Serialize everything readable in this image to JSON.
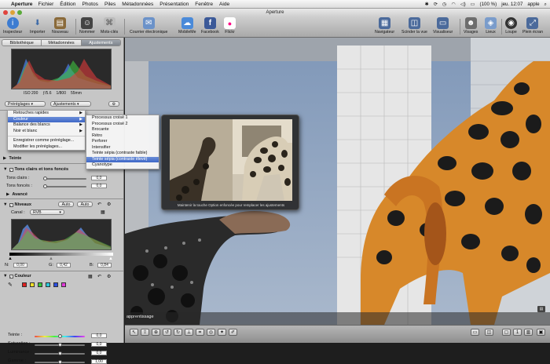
{
  "menubar": {
    "apple_glyph": "",
    "app_name": "Aperture",
    "items": [
      "Fichier",
      "Édition",
      "Photos",
      "Piles",
      "Métadonnées",
      "Présentation",
      "Fenêtre",
      "Aide"
    ],
    "battery": "(100 %)",
    "clock": "jeu. 12:07",
    "user": "apple"
  },
  "window": {
    "title": "Aperture"
  },
  "toolbar": {
    "left": [
      {
        "label": "Inspecteur",
        "icon": "info-icon",
        "color": "#3d7cd1"
      },
      {
        "label": "Importer",
        "icon": "import-arrow-icon",
        "color": "#5a7fb8"
      },
      {
        "label": "Nouveau",
        "icon": "new-project-icon",
        "color": "#8a6a3a"
      },
      {
        "label": "Nommer",
        "icon": "name-person-icon",
        "color": "#444444"
      },
      {
        "label": "Mots-clés",
        "icon": "keywords-icon",
        "color": "#bcbcbc"
      }
    ],
    "share": [
      {
        "label": "Courrier électronique",
        "icon": "email-stamp-icon",
        "color": "#6b92c9"
      },
      {
        "label": "MobileMe",
        "icon": "mobileme-cloud-icon",
        "color": "#4a8ad9"
      },
      {
        "label": "Facebook",
        "icon": "facebook-icon",
        "color": "#3b5998"
      },
      {
        "label": "Flickr",
        "icon": "flickr-icon",
        "color": "#ffffff"
      }
    ],
    "right": [
      {
        "label": "Navigateur",
        "icon": "browser-grid-icon",
        "color": "#4b6a9b"
      },
      {
        "label": "Scinder la vue",
        "icon": "split-view-icon",
        "color": "#4b6a9b"
      },
      {
        "label": "Visualiseur",
        "icon": "viewer-icon",
        "color": "#4b6a9b"
      },
      {
        "label": "Visages",
        "icon": "faces-icon",
        "color": "#6d6d6d"
      },
      {
        "label": "Lieux",
        "icon": "places-icon",
        "color": "#7a9ccb"
      },
      {
        "label": "Loupe",
        "icon": "loupe-icon",
        "color": "#333333"
      },
      {
        "label": "Plein écran",
        "icon": "fullscreen-icon",
        "color": "#4b6a9b"
      }
    ]
  },
  "inspector": {
    "tabs": [
      "Bibliothèque",
      "Métadonnées",
      "Ajustements"
    ],
    "active_tab": "Ajustements",
    "exif": [
      "ISO 200",
      "ƒ/5.6",
      "1/800",
      "55mm"
    ],
    "presets_label": "Préréglages",
    "adjustments_label": "Ajustements",
    "teinte": "Teinte",
    "shadows_title": "Tons clairs et tons foncés",
    "tons_clairs": "Tons clairs :",
    "tons_fonces": "Tons foncés :",
    "tons_clairs_value": "0,0",
    "tons_fonces_value": "0,0",
    "avance": "Avancé",
    "levels_title": "Niveaux",
    "auto1": "Auto",
    "auto2": "Auto",
    "canal_label": "Canal :",
    "canal_value": "RVB",
    "levels_n_label": "N:",
    "levels_n": "0,00",
    "levels_g_label": "G:",
    "levels_g": "0,42",
    "levels_b_label": "B:",
    "levels_b": "0,84",
    "color_title": "Couleur",
    "swatch_colors": [
      "#e02020",
      "#f2e02a",
      "#39c43a",
      "#2ac6d8",
      "#2a4ee0",
      "#e03ad8"
    ],
    "color_rows": [
      {
        "label": "Teinte :",
        "value": "0,0"
      },
      {
        "label": "Saturation :",
        "value": "0,0"
      },
      {
        "label": "Luminance :",
        "value": "0,0"
      },
      {
        "label": "Gamme :",
        "value": "1,00"
      }
    ]
  },
  "presets_menu": {
    "items": [
      "Retouches rapides",
      "Couleur",
      "Balance des blancs",
      "Noir et blanc"
    ],
    "selected": "Couleur",
    "extra": [
      "Enregistrer comme préréglage...",
      "Modifier les préréglages..."
    ]
  },
  "color_submenu": {
    "items": [
      "Processus croisé 1",
      "Processus croisé 2",
      "Brocante",
      "Rétro",
      "Perforer",
      "Intensifier",
      "Teinte sépia (contraste faible)",
      "Teinte sépia (contraste élevé)",
      "Cyanotype"
    ],
    "selected": "Teinte sépia (contraste élevé)"
  },
  "preview": {
    "hint": "Maintenir la touche Option enfoncée pour remplacer les ajustements"
  },
  "viewer": {
    "caption": "apprentissage"
  }
}
